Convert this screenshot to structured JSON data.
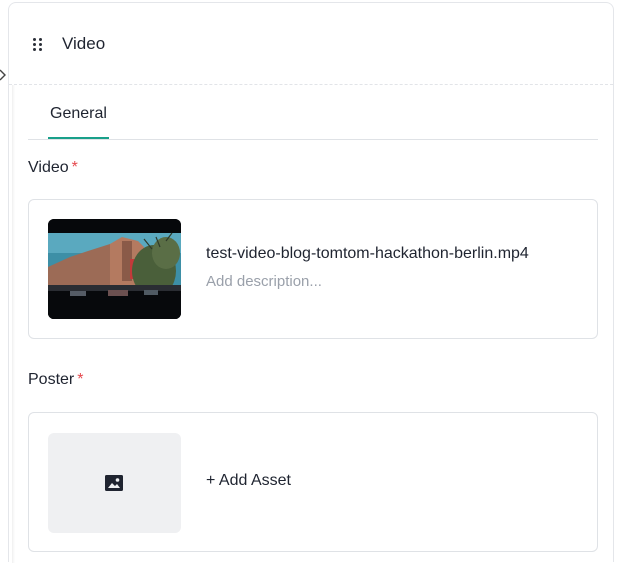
{
  "block": {
    "title": "Video",
    "icons": {
      "drag": "drag-handle-icon",
      "collapse": "chevron-right-icon"
    }
  },
  "tabs": [
    {
      "label": "General",
      "active": true
    }
  ],
  "video_field": {
    "label": "Video",
    "required_mark": "*",
    "file_name": "test-video-blog-tomtom-hackathon-berlin.mp4",
    "description_placeholder": "Add description..."
  },
  "poster_field": {
    "label": "Poster",
    "required_mark": "*",
    "add_label": "+ Add Asset",
    "icon": "image-icon"
  },
  "colors": {
    "accent": "#19a08a",
    "required": "#e5484d",
    "placeholder": "#9aa0aa",
    "border": "#dfe2e6",
    "thumb_bg": "#eff0f2"
  }
}
